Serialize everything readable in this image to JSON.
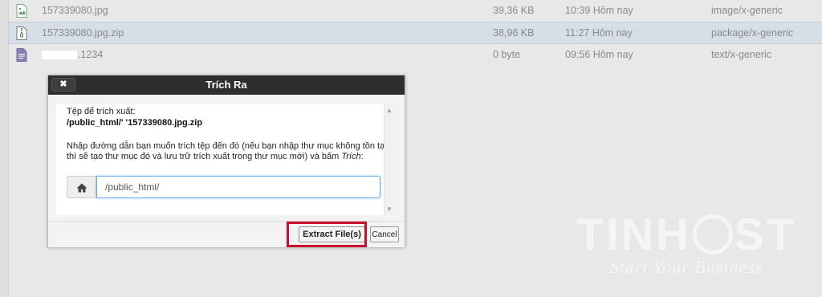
{
  "files": [
    {
      "name": "157339080.jpg",
      "size": "39,36 KB",
      "date": "10:39 Hôm nay",
      "type": "image/x-generic",
      "icon": "image-file-icon",
      "selected": false
    },
    {
      "name": "157339080.jpg.zip",
      "size": "38,96 KB",
      "date": "11:27 Hôm nay",
      "type": "package/x-generic",
      "icon": "zip-file-icon",
      "selected": true
    },
    {
      "name": ".1234",
      "size": "0 byte",
      "date": "09:56 Hôm nay",
      "type": "text/x-generic",
      "icon": "text-file-icon",
      "selected": false
    }
  ],
  "dialog": {
    "title": "Trích Ra",
    "close_label": "✖",
    "file_label": "Tệp để trích xuất:",
    "file_path": "/public_html/'                    '157339080.jpg.zip",
    "instruction": "Nhập đường dẫn bạn muốn trích tệp đến đó (nếu bạn nhập thư mục không tồn tại thì sẽ tạo thư mục đó và lưu trữ trích xuất trong thư mục mới) và bấm",
    "instruction_em": "Trích",
    "instruction_end": ":",
    "path_value": "/public_html/",
    "extract_label": "Extract File(s)",
    "cancel_label": "Cancel"
  },
  "watermark": {
    "brand_a": "TIN",
    "brand_b": "H",
    "brand_c": "ST",
    "tagline": "Start Your Business"
  },
  "colors": {
    "highlight": "#c8102e",
    "dialog_header": "#2e2e2e",
    "selected_row": "#d6dee8"
  }
}
